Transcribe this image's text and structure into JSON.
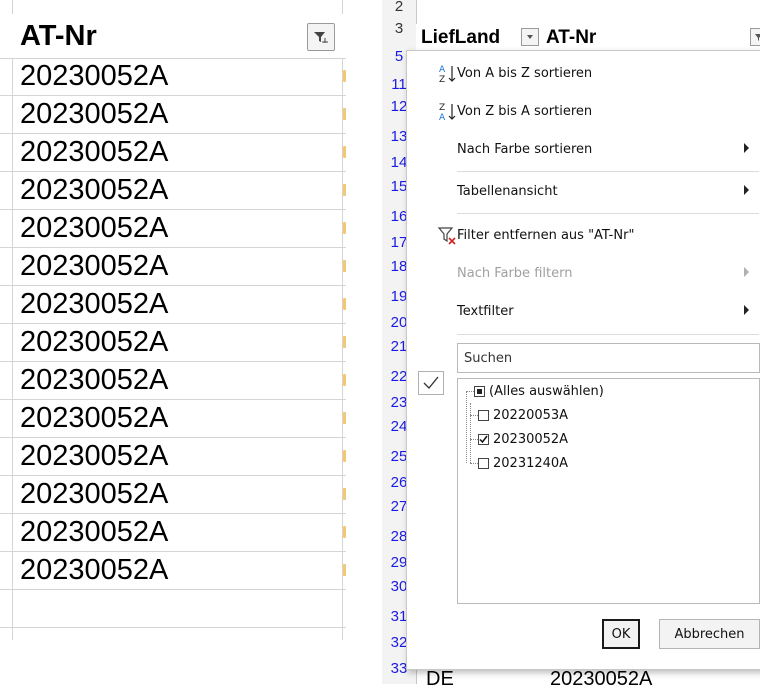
{
  "left_panel": {
    "header": "AT-Nr",
    "rows": [
      "20230052A",
      "20230052A",
      "20230052A",
      "20230052A",
      "20230052A",
      "20230052A",
      "20230052A",
      "20230052A",
      "20230052A",
      "20230052A",
      "20230052A",
      "20230052A",
      "20230052A",
      "20230052A"
    ]
  },
  "sheet": {
    "row_numbers": [
      "2",
      "3",
      "5",
      "11",
      "12",
      "13",
      "14",
      "15",
      "16",
      "17",
      "18",
      "19",
      "20",
      "21",
      "22",
      "23",
      "24",
      "25",
      "26",
      "27",
      "28",
      "29",
      "30",
      "31",
      "32",
      "33"
    ],
    "header_liefland": "LiefLand",
    "header_atnr": "AT-Nr",
    "bottom_liefland": "DE",
    "bottom_atnr": "20230052A"
  },
  "menu": {
    "sort_az": "Von A bis Z sortieren",
    "sort_za": "Von Z bis A sortieren",
    "sort_color": "Nach Farbe sortieren",
    "table_view": "Tabellenansicht",
    "clear_filter": "Filter entfernen aus \"AT-Nr\"",
    "filter_color": "Nach Farbe filtern",
    "text_filter": "Textfilter",
    "search_placeholder": "Suchen",
    "list_items": [
      {
        "label": "(Alles auswählen)",
        "state": "partial"
      },
      {
        "label": "20220053A",
        "state": "unchecked"
      },
      {
        "label": "20230052A",
        "state": "checked"
      },
      {
        "label": "20231240A",
        "state": "unchecked"
      }
    ],
    "ok": "OK",
    "cancel": "Abbrechen"
  }
}
